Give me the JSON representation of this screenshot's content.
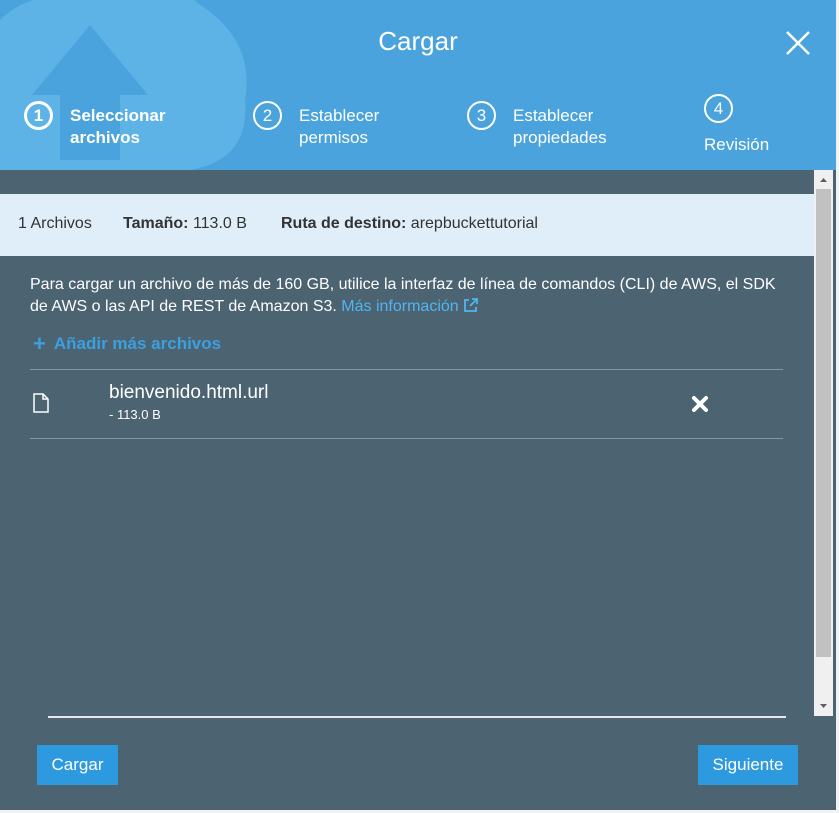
{
  "dialog": {
    "title": "Cargar",
    "close_icon": "close-icon"
  },
  "steps": [
    {
      "number": "1",
      "line1": "Seleccionar",
      "line2": "archivos",
      "active": true
    },
    {
      "number": "2",
      "line1": "Establecer",
      "line2": "permisos",
      "active": false
    },
    {
      "number": "3",
      "line1": "Establecer",
      "line2": "propiedades",
      "active": false
    },
    {
      "number": "4",
      "line1": "Revisión",
      "line2": "",
      "active": false
    }
  ],
  "summary": {
    "file_count": "1 Archivos",
    "size_label": "Tamaño:",
    "size_value": "113.0 B",
    "destination_label": "Ruta de destino:",
    "destination_value": "arepbuckettutorial"
  },
  "notice": {
    "text": "Para cargar un archivo de más de 160 GB, utilice la interfaz de línea de comandos (CLI) de AWS, el SDK de AWS o las API de REST de Amazon S3.",
    "link_label": "Más información"
  },
  "add_files_label": "Añadir más archivos",
  "files": [
    {
      "name": "bienvenido.html.url",
      "size": "- 113.0 B"
    }
  ],
  "footer": {
    "upload_label": "Cargar",
    "next_label": "Siguiente"
  },
  "colors": {
    "header": "#4aa3dc",
    "body": "#4c6372",
    "summary": "#dfeef8",
    "accent": "#2d9ae0",
    "link": "#4fb6f2"
  }
}
